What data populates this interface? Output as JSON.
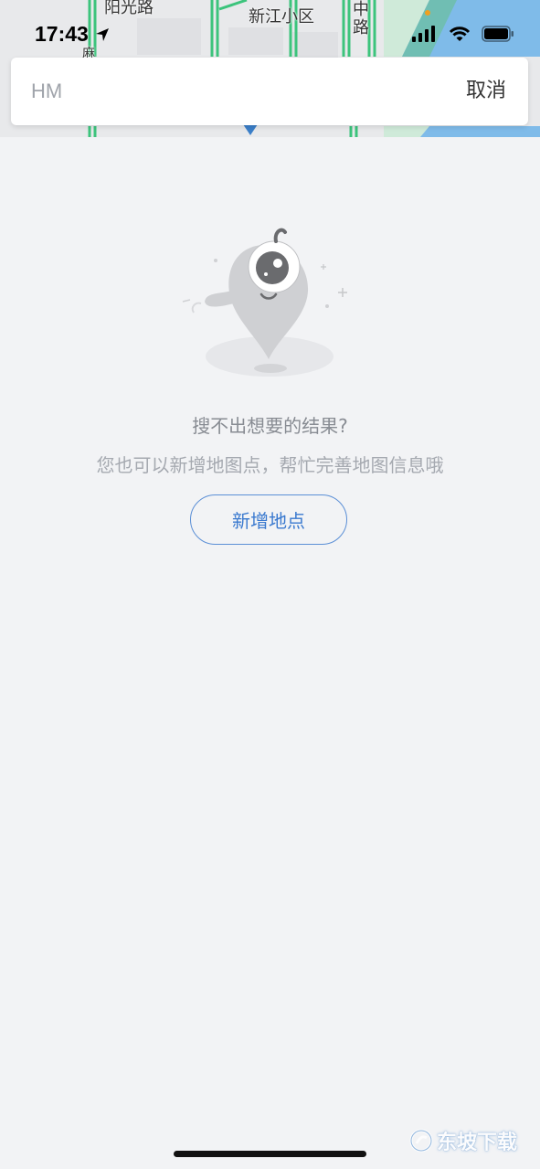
{
  "status_bar": {
    "time": "17:43"
  },
  "map": {
    "labels": {
      "road_top_left": "阳光路",
      "community": "新江小区",
      "road_right": "中路",
      "fragment_left": "麻"
    }
  },
  "search": {
    "value": "HM",
    "cancel_label": "取消"
  },
  "empty_state": {
    "title": "搜不出想要的结果?",
    "description": "您也可以新增地图点，帮忙完善地图信息哦",
    "add_button_label": "新增地点"
  },
  "watermark": {
    "text": "东坡下载"
  },
  "colors": {
    "background": "#f2f3f5",
    "accent": "#3a79cf",
    "map_road_green": "#3cc47c",
    "map_water": "#78b8ea"
  },
  "icons": [
    "location-arrow-icon",
    "cellular-signal-icon",
    "wifi-icon",
    "battery-icon",
    "map-pin-icon",
    "mascot-illustration"
  ]
}
